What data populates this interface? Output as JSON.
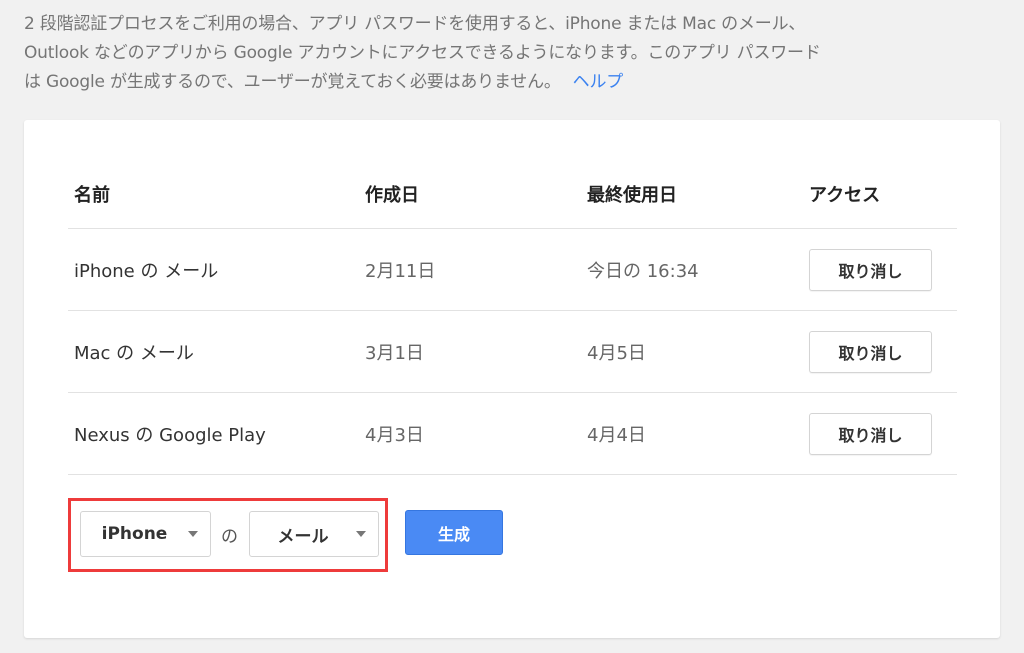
{
  "intro": {
    "lines": [
      "2 段階認証プロセスをご利用の場合、アプリ パスワードを使用すると、iPhone または Mac のメール、",
      "Outlook などのアプリから Google アカウントにアクセスできるようになります。このアプリ パスワード",
      "は Google が生成するので、ユーザーが覚えておく必要はありません。"
    ],
    "help_link": "ヘルプ"
  },
  "table": {
    "headers": {
      "name": "名前",
      "created": "作成日",
      "last_used": "最終使用日",
      "access": "アクセス"
    },
    "rows": [
      {
        "name": "iPhone の メール",
        "created": "2月11日",
        "last_used": "今日の 16:34",
        "action": "取り消し"
      },
      {
        "name": "Mac の メール",
        "created": "3月1日",
        "last_used": "4月5日",
        "action": "取り消し"
      },
      {
        "name": "Nexus の Google Play",
        "created": "4月3日",
        "last_used": "4月4日",
        "action": "取り消し"
      }
    ]
  },
  "generator": {
    "device_select": "iPhone",
    "of_text": "の",
    "app_select": "メール",
    "generate_label": "生成"
  },
  "colors": {
    "link": "#3b82f0",
    "primary_button": "#4a8af4",
    "highlight_border": "#ee3b3b"
  }
}
